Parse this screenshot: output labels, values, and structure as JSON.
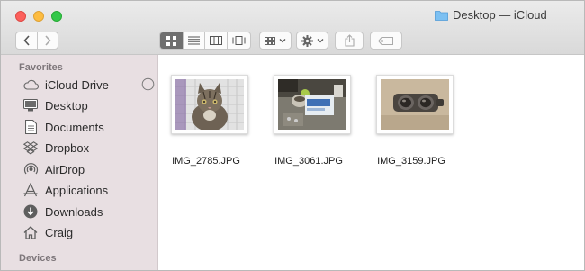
{
  "window": {
    "title": "Desktop — iCloud"
  },
  "sidebar": {
    "favorites_label": "Favorites",
    "devices_label": "Devices",
    "items": [
      {
        "label": "iCloud Drive",
        "icon": "cloud-icon"
      },
      {
        "label": "Desktop",
        "icon": "desktop-icon"
      },
      {
        "label": "Documents",
        "icon": "document-icon"
      },
      {
        "label": "Dropbox",
        "icon": "dropbox-icon"
      },
      {
        "label": "AirDrop",
        "icon": "airdrop-icon"
      },
      {
        "label": "Applications",
        "icon": "applications-icon"
      },
      {
        "label": "Downloads",
        "icon": "downloads-icon"
      },
      {
        "label": "Craig",
        "icon": "home-icon"
      }
    ]
  },
  "files": [
    {
      "name": "IMG_2785.JPG",
      "thumbnail": "cat-photo"
    },
    {
      "name": "IMG_3061.JPG",
      "thumbnail": "desk-photo"
    },
    {
      "name": "IMG_3159.JPG",
      "thumbnail": "glasses-photo"
    }
  ],
  "toolbar": {
    "view_modes": [
      "icon-view",
      "list-view",
      "column-view",
      "cover-flow-view"
    ],
    "active_view": "icon-view"
  },
  "colors": {
    "sidebar_bg": "#e8dfe2",
    "folder_blue": "#5aa9e6"
  }
}
